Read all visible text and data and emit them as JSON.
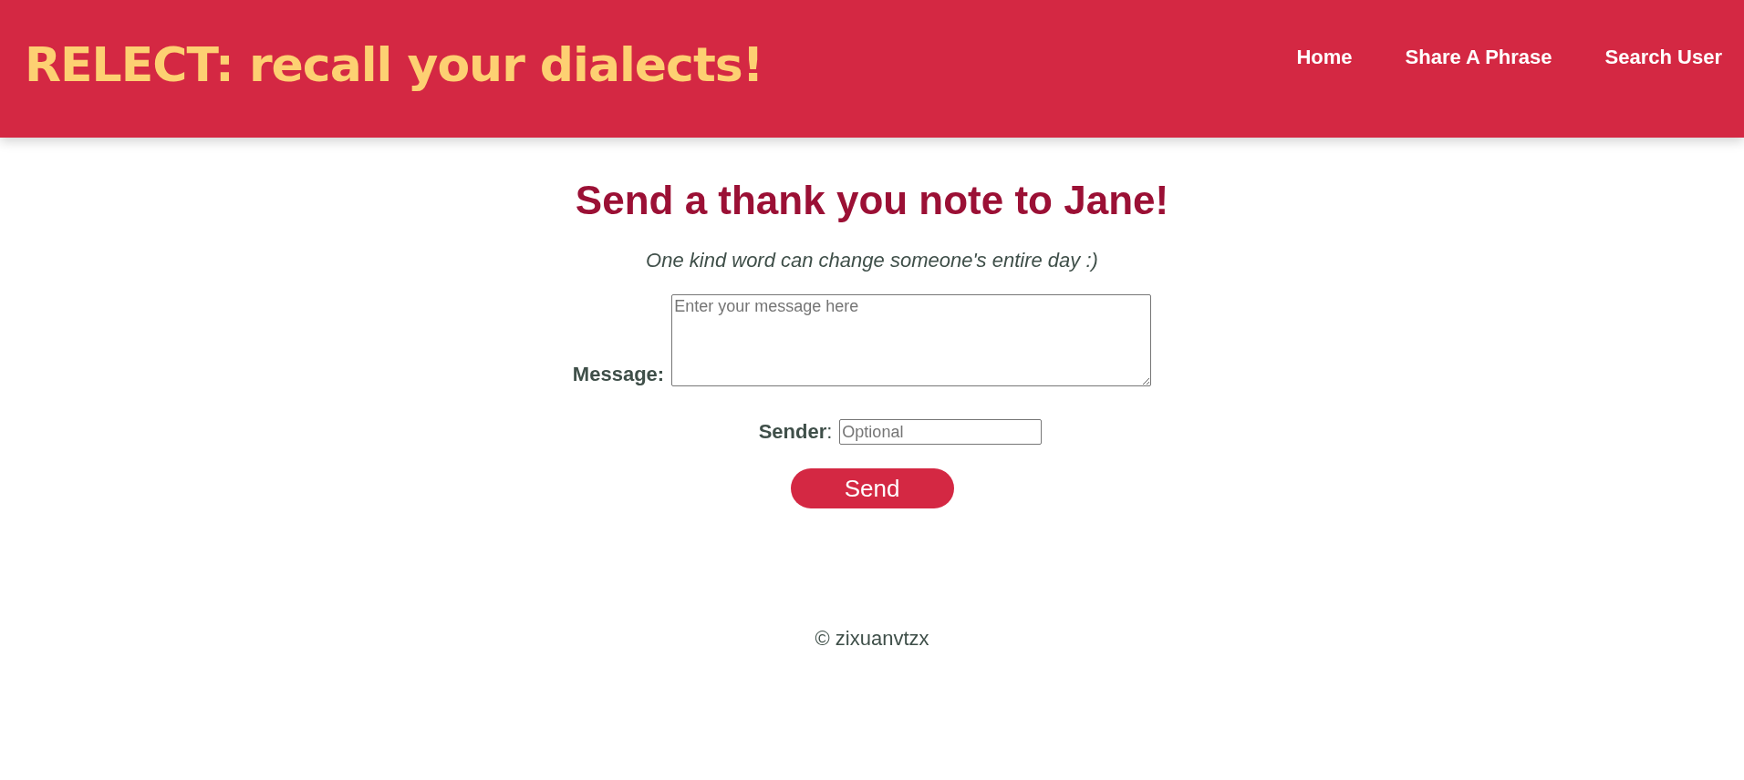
{
  "header": {
    "logo": "RELECT: recall your dialects!",
    "nav": [
      {
        "label": "Home"
      },
      {
        "label": "Share A Phrase"
      },
      {
        "label": "Search User"
      }
    ]
  },
  "main": {
    "title": "Send a thank you note to Jane!",
    "subtitle": "One kind word can change someone's entire day :)",
    "message": {
      "label": "Message:",
      "placeholder": "Enter your message here"
    },
    "sender": {
      "label": "**Sender**:",
      "placeholder": "Optional"
    },
    "button": "Send"
  },
  "footer": "© zixuanvtzx"
}
